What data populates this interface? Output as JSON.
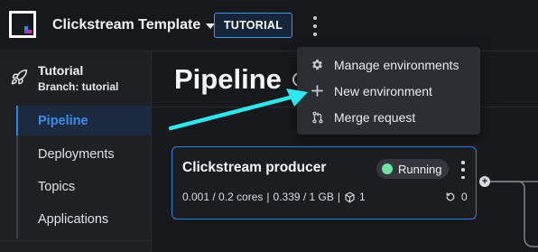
{
  "header": {
    "project_name": "Clickstream Template",
    "badge": "TUTORIAL"
  },
  "sidebar": {
    "environment_name": "Tutorial",
    "branch": "Branch: tutorial",
    "items": [
      {
        "label": "Pipeline",
        "active": true
      },
      {
        "label": "Deployments",
        "active": false
      },
      {
        "label": "Topics",
        "active": false
      },
      {
        "label": "Applications",
        "active": false
      }
    ]
  },
  "main": {
    "title": "Pipeline"
  },
  "card": {
    "name": "Clickstream producer",
    "status": "Running",
    "cpu": "0.001 / 0.2 cores",
    "memory": "0.339 / 1 GB",
    "replicas": "1",
    "restarts": "0"
  },
  "menu": {
    "items": [
      {
        "label": "Manage environments",
        "icon": "gear-icon"
      },
      {
        "label": "New environment",
        "icon": "plus-icon"
      },
      {
        "label": "Merge request",
        "icon": "merge-request-icon"
      }
    ]
  },
  "colors": {
    "accent": "#2f86ea",
    "annotation_arrow": "#2ee6ee",
    "status_running": "#6fe3a1"
  }
}
